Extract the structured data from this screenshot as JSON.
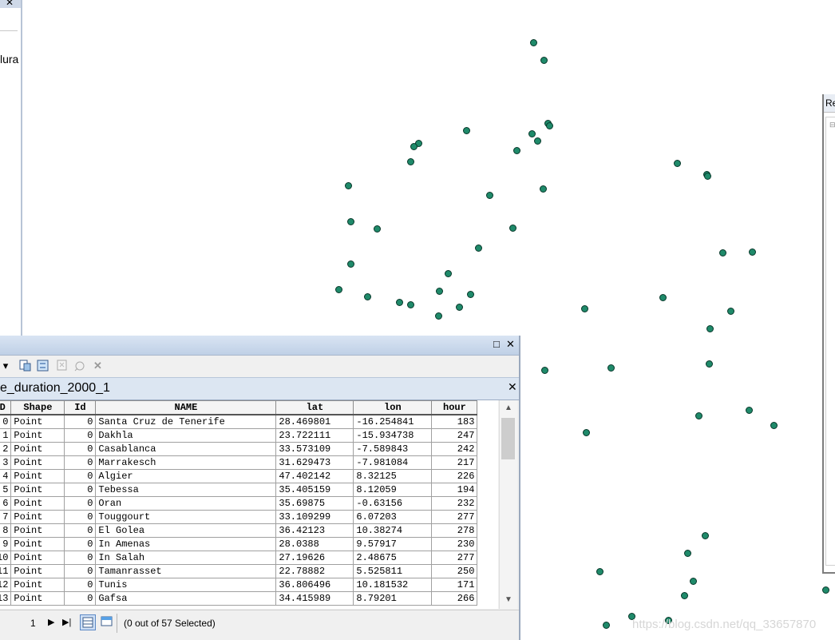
{
  "toc": {
    "partial_label": "lura"
  },
  "right_panel": {
    "header_partial": "Re",
    "tree_marker": "⊟"
  },
  "table_window": {
    "title": "e_duration_2000_1",
    "columns": [
      "D",
      "Shape",
      "Id",
      "NAME",
      "lat",
      "lon",
      "hour"
    ],
    "rows": [
      [
        "0",
        "Point",
        "0",
        "Santa Cruz de Tenerife",
        "28.469801",
        "-16.254841",
        "183"
      ],
      [
        "1",
        "Point",
        "0",
        "Dakhla",
        "23.722111",
        "-15.934738",
        "247"
      ],
      [
        "2",
        "Point",
        "0",
        "Casablanca",
        "33.573109",
        "-7.589843",
        "242"
      ],
      [
        "3",
        "Point",
        "0",
        "Marrakesch",
        "31.629473",
        "-7.981084",
        "217"
      ],
      [
        "4",
        "Point",
        "0",
        "Algier",
        "47.402142",
        "8.32125",
        "226"
      ],
      [
        "5",
        "Point",
        "0",
        "Tebessa",
        "35.405159",
        "8.12059",
        "194"
      ],
      [
        "6",
        "Point",
        "0",
        "Oran",
        "35.69875",
        "-0.63156",
        "232"
      ],
      [
        "7",
        "Point",
        "0",
        "Touggourt",
        "33.109299",
        "6.07203",
        "277"
      ],
      [
        "8",
        "Point",
        "0",
        "El Golea",
        "36.42123",
        "10.38274",
        "278"
      ],
      [
        "9",
        "Point",
        "0",
        "In Amenas",
        "28.0388",
        "9.57917",
        "230"
      ],
      [
        "10",
        "Point",
        "0",
        "In Salah",
        "27.19626",
        "2.48675",
        "277"
      ],
      [
        "11",
        "Point",
        "0",
        "Tamanrasset",
        "22.78882",
        "5.525811",
        "250"
      ],
      [
        "12",
        "Point",
        "0",
        "Tunis",
        "36.806496",
        "10.181532",
        "171"
      ],
      [
        "13",
        "Point",
        "0",
        "Gafsa",
        "34.415989",
        "8.79201",
        "266"
      ]
    ],
    "page_number": "1",
    "selection_status": "(0 out of 57 Selected)"
  },
  "watermark": "https://blog.csdn.net/qq_33657870",
  "colors": {
    "point_fill": "#1f8a6a",
    "point_outline": "#08382a",
    "tab_bg": "#dce6f2"
  },
  "icons": [
    "dropdown-arrow-icon",
    "select-by-attributes-icon",
    "switch-selection-icon",
    "clear-selection-icon",
    "zoom-to-selected-icon",
    "delete-selected-icon"
  ]
}
